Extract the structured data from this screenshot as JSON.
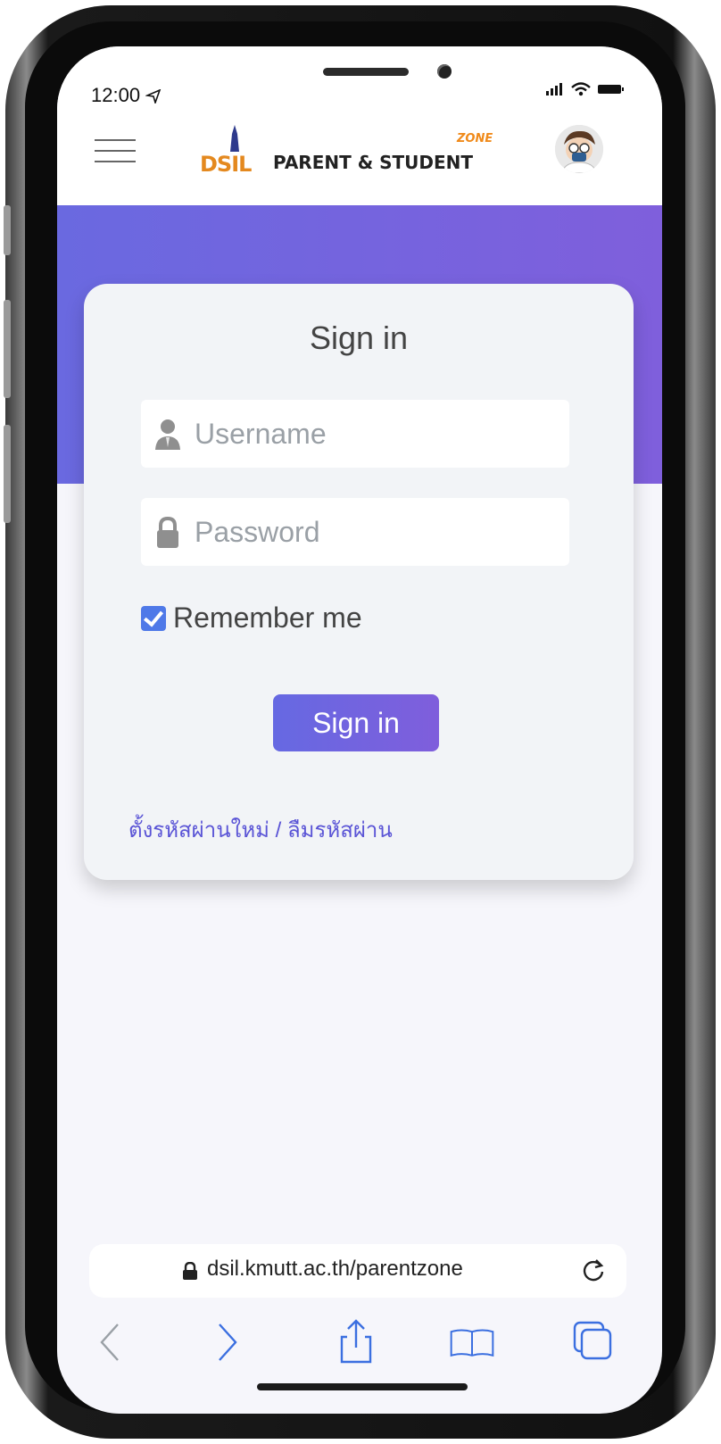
{
  "status": {
    "time": "12:00"
  },
  "header": {
    "brand_short": "DSIL",
    "brand_title": "PARENT & STUDENT",
    "brand_zone": "ZONE"
  },
  "card": {
    "title": "Sign in",
    "username_placeholder": "Username",
    "password_placeholder": "Password",
    "remember_label": "Remember me",
    "remember_checked": true,
    "submit_label": "Sign in",
    "reset_link": "ตั้งรหัสผ่านใหม่ / ลืมรหัสผ่าน"
  },
  "browser": {
    "url": "dsil.kmutt.ac.th/parentzone"
  },
  "colors": {
    "accent_start": "#6a69e0",
    "accent_end": "#7f5fdc",
    "link": "#5a54d6",
    "brand_orange": "#e4891f"
  },
  "icons": {
    "menu": "hamburger-icon",
    "user": "user-icon",
    "lock": "lock-icon",
    "reload": "reload-icon",
    "back": "chevron-left-icon",
    "forward": "chevron-right-icon",
    "share": "share-icon",
    "bookmarks": "book-icon",
    "tabs": "tabs-icon"
  }
}
